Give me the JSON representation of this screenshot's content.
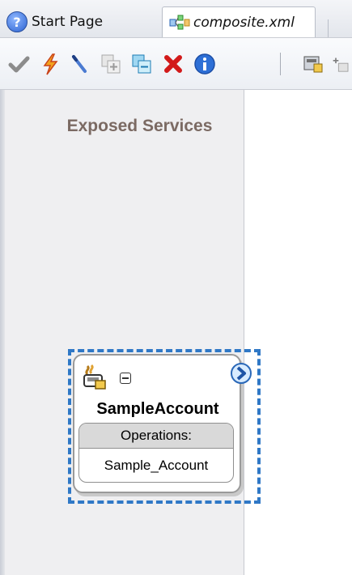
{
  "tabs": [
    {
      "label": "Start Page",
      "icon": "help-icon"
    },
    {
      "label": "composite.xml",
      "icon": "composite-icon"
    }
  ],
  "toolbar": {
    "buttons": [
      {
        "name": "validate-icon"
      },
      {
        "name": "lightning-icon"
      },
      {
        "name": "pen-icon"
      },
      {
        "name": "expand-icon"
      },
      {
        "name": "collapse-icon"
      },
      {
        "name": "delete-icon"
      },
      {
        "name": "info-icon"
      },
      {
        "name": "database-icon"
      },
      {
        "name": "add-icon"
      }
    ]
  },
  "panel": {
    "title": "Exposed Services"
  },
  "service": {
    "name": "SampleAccount",
    "operations_header": "Operations:",
    "operations": [
      "Sample_Account"
    ]
  },
  "colors": {
    "selection": "#2f78c6",
    "panel_title": "#7b6a63",
    "panel_bg": "#efeff1"
  }
}
